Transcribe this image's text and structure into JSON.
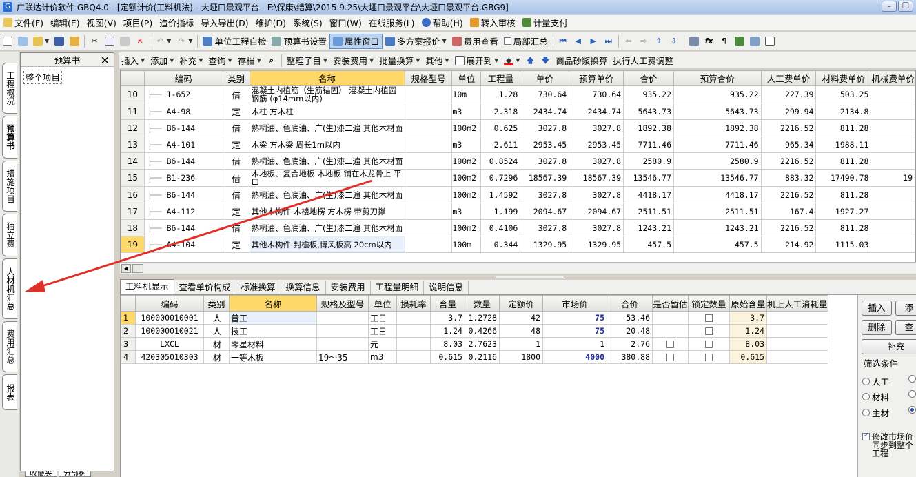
{
  "title": "广联达计价软件 GBQ4.0 - [定额计价(工料机法) - 大垭口景观平台 - F:\\保康\\结算\\2015.9.25\\大垭口景观平台\\大垭口景观平台.GBG9]",
  "menu": [
    "文件(F)",
    "编辑(E)",
    "视图(V)",
    "项目(P)",
    "造价指标",
    "导入导出(D)",
    "维护(D)",
    "系统(S)",
    "窗口(W)",
    "在线服务(L)",
    "帮助(H)",
    "转入审核",
    "计量支付"
  ],
  "toolbar1": {
    "self_check": "单位工程自检",
    "budget_settings": "预算书设置",
    "attr_window": "属性窗口",
    "multi_quote": "多方案报价",
    "fee_view": "费用查看",
    "partial_summary": "局部汇总"
  },
  "toolbar2": [
    "插入",
    "添加",
    "补充",
    "查询",
    "存档",
    "整理子目",
    "安装费用",
    "批量换算",
    "其他",
    "展开到",
    "商品砂浆换算",
    "执行人工费调整"
  ],
  "side_tabs": [
    "工程概况",
    "预算书",
    "措施项目",
    "独立费",
    "人材机汇总",
    "费用汇总",
    "报表"
  ],
  "left_panel": {
    "title": "预算书",
    "close": "✕",
    "node": "整个项目",
    "bottom_tabs": [
      "收藏夹",
      "分部树"
    ]
  },
  "upper_table": {
    "headers": [
      "",
      "编码",
      "类别",
      "名称",
      "规格型号",
      "单位",
      "工程量",
      "单价",
      "预算单价",
      "合价",
      "预算合价",
      "人工费单价",
      "材料费单价",
      "机械费单价"
    ],
    "rows": [
      {
        "no": "10",
        "code": "1-652",
        "type": "借",
        "name": "混凝土内植筋（生筋锚固） 混凝土内植圆钢筋 (φ14mm以内)",
        "unit": "10m",
        "qty": "1.28",
        "price": "730.64",
        "bprice": "730.64",
        "total": "935.22",
        "btotal": "935.22",
        "labor": "227.39",
        "mat": "503.25",
        "mach": ""
      },
      {
        "no": "11",
        "code": "A4-98",
        "type": "定",
        "name": "木柱 方木柱",
        "unit": "m3",
        "qty": "2.318",
        "price": "2434.74",
        "bprice": "2434.74",
        "total": "5643.73",
        "btotal": "5643.73",
        "labor": "299.94",
        "mat": "2134.8",
        "mach": ""
      },
      {
        "no": "12",
        "code": "B6-144",
        "type": "借",
        "name": "熟桐油、色底油、广(生)漆二遍 其他木材面",
        "unit": "100m2",
        "qty": "0.625",
        "price": "3027.8",
        "bprice": "3027.8",
        "total": "1892.38",
        "btotal": "1892.38",
        "labor": "2216.52",
        "mat": "811.28",
        "mach": ""
      },
      {
        "no": "13",
        "code": "A4-101",
        "type": "定",
        "name": "木梁 方木梁 周长1m以内",
        "unit": "m3",
        "qty": "2.611",
        "price": "2953.45",
        "bprice": "2953.45",
        "total": "7711.46",
        "btotal": "7711.46",
        "labor": "965.34",
        "mat": "1988.11",
        "mach": ""
      },
      {
        "no": "14",
        "code": "B6-144",
        "type": "借",
        "name": "熟桐油、色底油、广(生)漆二遍 其他木材面",
        "unit": "100m2",
        "qty": "0.8524",
        "price": "3027.8",
        "bprice": "3027.8",
        "total": "2580.9",
        "btotal": "2580.9",
        "labor": "2216.52",
        "mat": "811.28",
        "mach": ""
      },
      {
        "no": "15",
        "code": "B1-236",
        "type": "借",
        "name": "木地板、复合地板 木地板 铺在木龙骨上 平口",
        "unit": "100m2",
        "qty": "0.7296",
        "price": "18567.39",
        "bprice": "18567.39",
        "total": "13546.77",
        "btotal": "13546.77",
        "labor": "883.32",
        "mat": "17490.78",
        "mach": "19"
      },
      {
        "no": "16",
        "code": "B6-144",
        "type": "借",
        "name": "熟桐油、色底油、广(生)漆二遍 其他木材面",
        "unit": "100m2",
        "qty": "1.4592",
        "price": "3027.8",
        "bprice": "3027.8",
        "total": "4418.17",
        "btotal": "4418.17",
        "labor": "2216.52",
        "mat": "811.28",
        "mach": ""
      },
      {
        "no": "17",
        "code": "A4-112",
        "type": "定",
        "name": "其他木构件 木楼地楞 方木楞 带剪刀撑",
        "unit": "m3",
        "qty": "1.199",
        "price": "2094.67",
        "bprice": "2094.67",
        "total": "2511.51",
        "btotal": "2511.51",
        "labor": "167.4",
        "mat": "1927.27",
        "mach": ""
      },
      {
        "no": "18",
        "code": "B6-144",
        "type": "借",
        "name": "熟桐油、色底油、广(生)漆二遍 其他木材面",
        "unit": "100m2",
        "qty": "0.4106",
        "price": "3027.8",
        "bprice": "3027.8",
        "total": "1243.21",
        "btotal": "1243.21",
        "labor": "2216.52",
        "mat": "811.28",
        "mach": ""
      },
      {
        "no": "19",
        "code": "A4-104",
        "type": "定",
        "name": "其他木构件 封檐板,博风板高 20cm以内",
        "unit": "100m",
        "qty": "0.344",
        "price": "1329.95",
        "bprice": "1329.95",
        "total": "457.5",
        "btotal": "457.5",
        "labor": "214.92",
        "mat": "1115.03",
        "mach": ""
      }
    ]
  },
  "bottom_tabs": [
    "工料机显示",
    "查看单价构成",
    "标准换算",
    "换算信息",
    "安装费用",
    "工程量明细",
    "说明信息"
  ],
  "lower_table": {
    "headers": [
      "",
      "编码",
      "类别",
      "名称",
      "规格及型号",
      "单位",
      "损耗率",
      "含量",
      "数量",
      "定额价",
      "市场价",
      "合价",
      "是否暂估",
      "锁定数量",
      "原始含量",
      "机上人工消耗量"
    ],
    "rows": [
      {
        "no": "1",
        "code": "100000010001",
        "type": "人",
        "name": "普工",
        "spec": "",
        "unit": "工日",
        "loss": "",
        "content": "3.7",
        "qty": "1.2728",
        "quota": "42",
        "market": "75",
        "total": "53.46",
        "est": false,
        "lock": true,
        "orig": "3.7"
      },
      {
        "no": "2",
        "code": "100000010021",
        "type": "人",
        "name": "技工",
        "spec": "",
        "unit": "工日",
        "loss": "",
        "content": "1.24",
        "qty": "0.4266",
        "quota": "48",
        "market": "75",
        "total": "20.48",
        "est": false,
        "lock": true,
        "orig": "1.24"
      },
      {
        "no": "3",
        "code": "LXCL",
        "type": "材",
        "name": "零星材料",
        "spec": "",
        "unit": "元",
        "loss": "",
        "content": "8.03",
        "qty": "2.7623",
        "quota": "1",
        "market": "1",
        "total": "2.76",
        "est": true,
        "lock": true,
        "orig": "8.03"
      },
      {
        "no": "4",
        "code": "420305010303",
        "type": "材",
        "name": "一等木板",
        "spec": "19～35",
        "unit": "m3",
        "loss": "",
        "content": "0.615",
        "qty": "0.2116",
        "quota": "1800",
        "market": "4000",
        "total": "380.88",
        "est": true,
        "lock": true,
        "orig": "0.615"
      }
    ]
  },
  "right_panel": {
    "insert": "插入",
    "add": "添",
    "delete": "删除",
    "query": "查",
    "supplement": "补充",
    "filter_label": "筛选条件",
    "radios": [
      "人工",
      "材料",
      "主材"
    ],
    "check_text": "修改市场价同步到整个工程"
  },
  "colors": {
    "highlight": "#ffd86a",
    "market_price": "#1b2a9c",
    "arrow": "#e0302a"
  }
}
